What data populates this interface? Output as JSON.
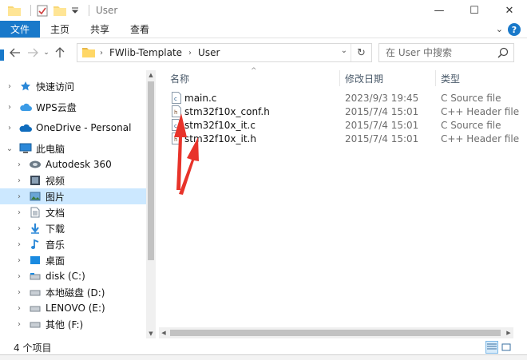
{
  "window": {
    "title": "User",
    "controls": [
      "—",
      "☐",
      "✕"
    ]
  },
  "ribbon": {
    "tabs": [
      "文件",
      "主页",
      "共享",
      "查看"
    ]
  },
  "nav": {
    "breadcrumbs": [
      "FWlib-Template",
      "User"
    ],
    "search_placeholder": "在 User 中搜索"
  },
  "sidebar": {
    "items": [
      {
        "label": "快速访问",
        "icon": "star-icon"
      },
      {
        "label": "WPS云盘",
        "icon": "cloud-icon"
      },
      {
        "label": "OneDrive - Personal",
        "icon": "onedrive-icon"
      },
      {
        "label": "此电脑",
        "icon": "computer-icon"
      },
      {
        "label": "Autodesk 360",
        "icon": "autodesk-icon"
      },
      {
        "label": "视频",
        "icon": "video-icon"
      },
      {
        "label": "图片",
        "icon": "picture-icon"
      },
      {
        "label": "文档",
        "icon": "document-icon"
      },
      {
        "label": "下载",
        "icon": "download-icon"
      },
      {
        "label": "音乐",
        "icon": "music-icon"
      },
      {
        "label": "桌面",
        "icon": "desktop-icon"
      },
      {
        "label": "disk (C:)",
        "icon": "drive-icon"
      },
      {
        "label": "本地磁盘 (D:)",
        "icon": "drive-icon"
      },
      {
        "label": "LENOVO (E:)",
        "icon": "drive-icon"
      },
      {
        "label": "其他 (F:)",
        "icon": "drive-icon"
      }
    ]
  },
  "filelist": {
    "columns": [
      "名称",
      "修改日期",
      "类型"
    ],
    "files": [
      {
        "name": "main.c",
        "date": "2023/9/3 19:45",
        "type": "C Source file",
        "icon": "c-file-icon"
      },
      {
        "name": "stm32f10x_conf.h",
        "date": "2015/7/4 15:01",
        "type": "C++ Header file",
        "icon": "h-file-icon"
      },
      {
        "name": "stm32f10x_it.c",
        "date": "2015/7/4 15:01",
        "type": "C Source file",
        "icon": "c-file-icon"
      },
      {
        "name": "stm32f10x_it.h",
        "date": "2015/7/4 15:01",
        "type": "C++ Header file",
        "icon": "h-file-icon"
      }
    ]
  },
  "status": {
    "count": "4 个项目"
  },
  "colors": {
    "accent": "#1979ca",
    "selected": "#cce8ff",
    "annotation": "#e8332a"
  }
}
